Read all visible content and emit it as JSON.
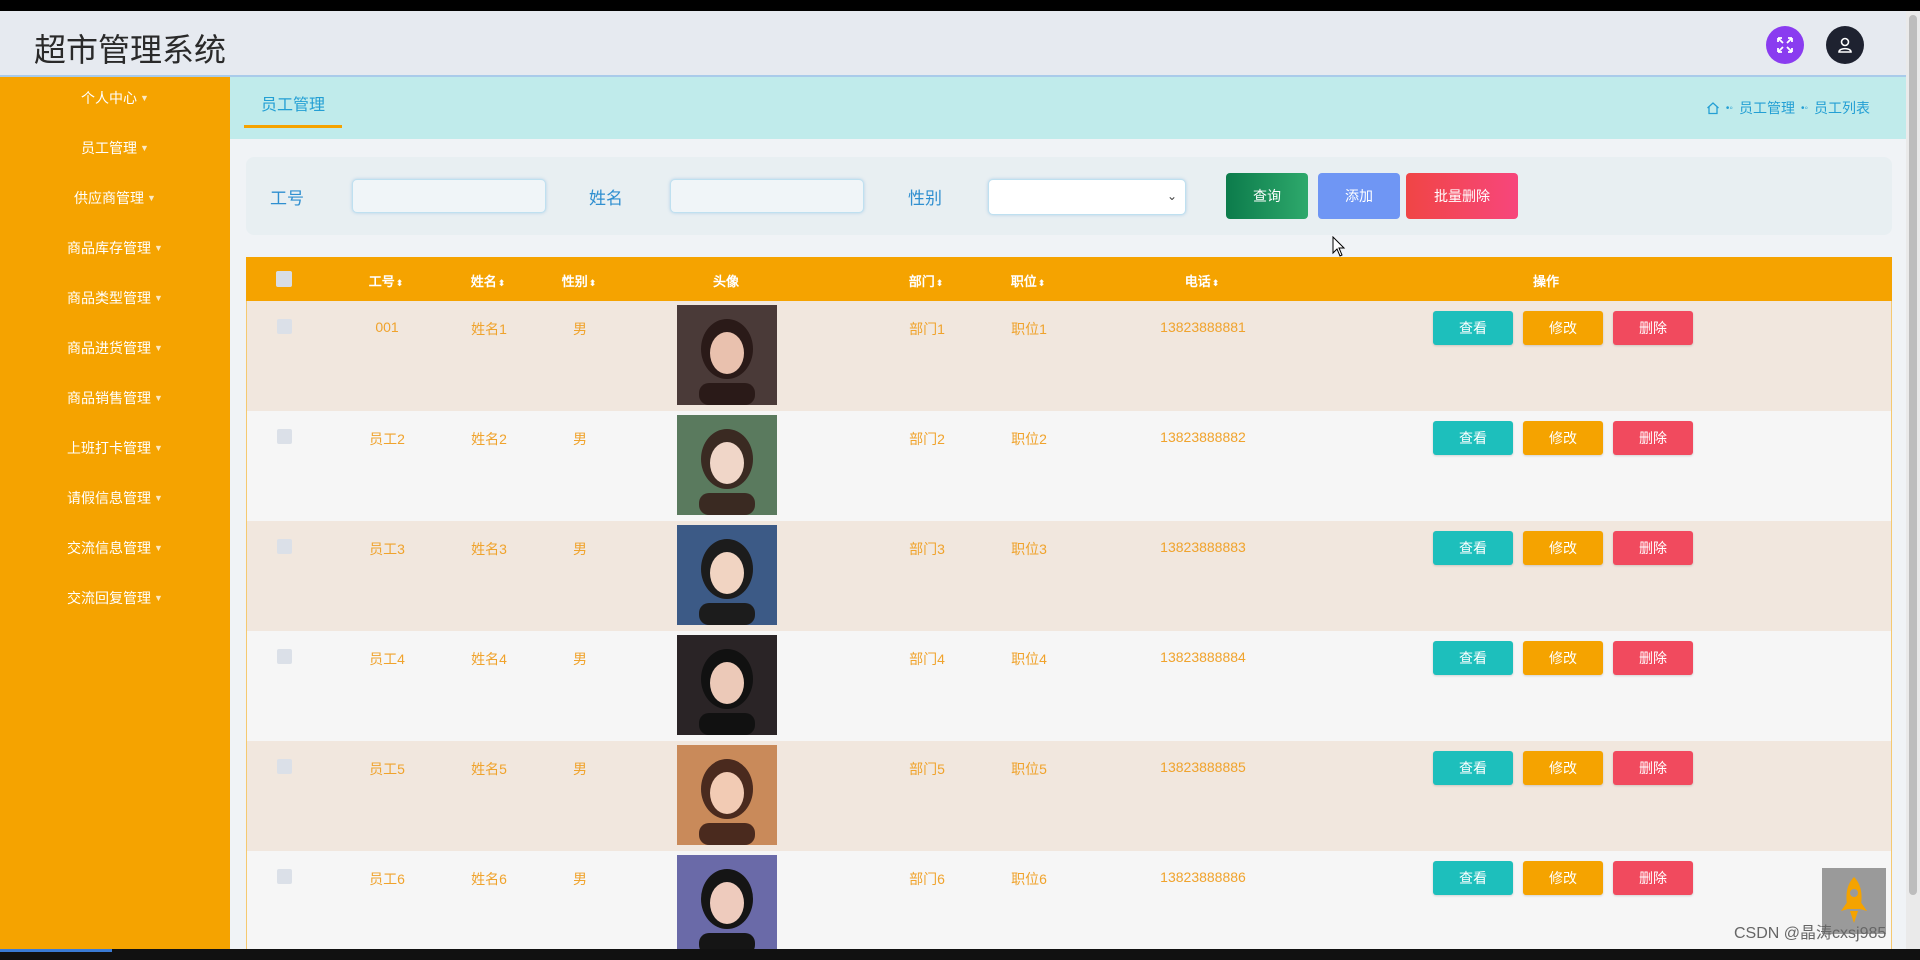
{
  "app": {
    "title": "超市管理系统"
  },
  "sidebar": {
    "items": [
      {
        "label": "个人中心"
      },
      {
        "label": "员工管理"
      },
      {
        "label": "供应商管理"
      },
      {
        "label": "商品库存管理"
      },
      {
        "label": "商品类型管理"
      },
      {
        "label": "商品进货管理"
      },
      {
        "label": "商品销售管理"
      },
      {
        "label": "上班打卡管理"
      },
      {
        "label": "请假信息管理"
      },
      {
        "label": "交流信息管理"
      },
      {
        "label": "交流回复管理"
      }
    ]
  },
  "tabs": {
    "active": "员工管理"
  },
  "breadcrumb": {
    "level1": "员工管理",
    "level2": "员工列表"
  },
  "search": {
    "id_label": "工号",
    "id_value": "",
    "name_label": "姓名",
    "name_value": "",
    "gender_label": "性别",
    "gender_value": "",
    "query_button": "查询",
    "add_button": "添加",
    "batch_delete_button": "批量删除"
  },
  "table": {
    "headers": [
      "工号",
      "姓名",
      "性别",
      "头像",
      "部门",
      "职位",
      "电话",
      "操作"
    ],
    "rows": [
      {
        "id": "001",
        "name": "姓名1",
        "gender": "男",
        "dept": "部门1",
        "position": "职位1",
        "phone": "13823888881"
      },
      {
        "id": "员工2",
        "name": "姓名2",
        "gender": "男",
        "dept": "部门2",
        "position": "职位2",
        "phone": "13823888882"
      },
      {
        "id": "员工3",
        "name": "姓名3",
        "gender": "男",
        "dept": "部门3",
        "position": "职位3",
        "phone": "13823888883"
      },
      {
        "id": "员工4",
        "name": "姓名4",
        "gender": "男",
        "dept": "部门4",
        "position": "职位4",
        "phone": "13823888884"
      },
      {
        "id": "员工5",
        "name": "姓名5",
        "gender": "男",
        "dept": "部门5",
        "position": "职位5",
        "phone": "13823888885"
      },
      {
        "id": "员工6",
        "name": "姓名6",
        "gender": "男",
        "dept": "部门6",
        "position": "职位6",
        "phone": "13823888886"
      }
    ],
    "actions": {
      "view": "查看",
      "edit": "修改",
      "delete": "删除"
    }
  },
  "watermark": "CSDN @晶涛cxsj985",
  "colors": {
    "sidebar": "#f5a300",
    "header_bar": "#f5a300",
    "tabbar": "#c0ebeb",
    "view": "#1dbfbc",
    "edit": "#f5a300",
    "delete": "#f14a5e",
    "add": "#6f96f4",
    "query": "#1a8e58",
    "batch_delete": "#f2455f"
  },
  "icons": [
    "expand-icon",
    "user-icon",
    "home-icon",
    "rocket-icon",
    "cursor-icon"
  ]
}
